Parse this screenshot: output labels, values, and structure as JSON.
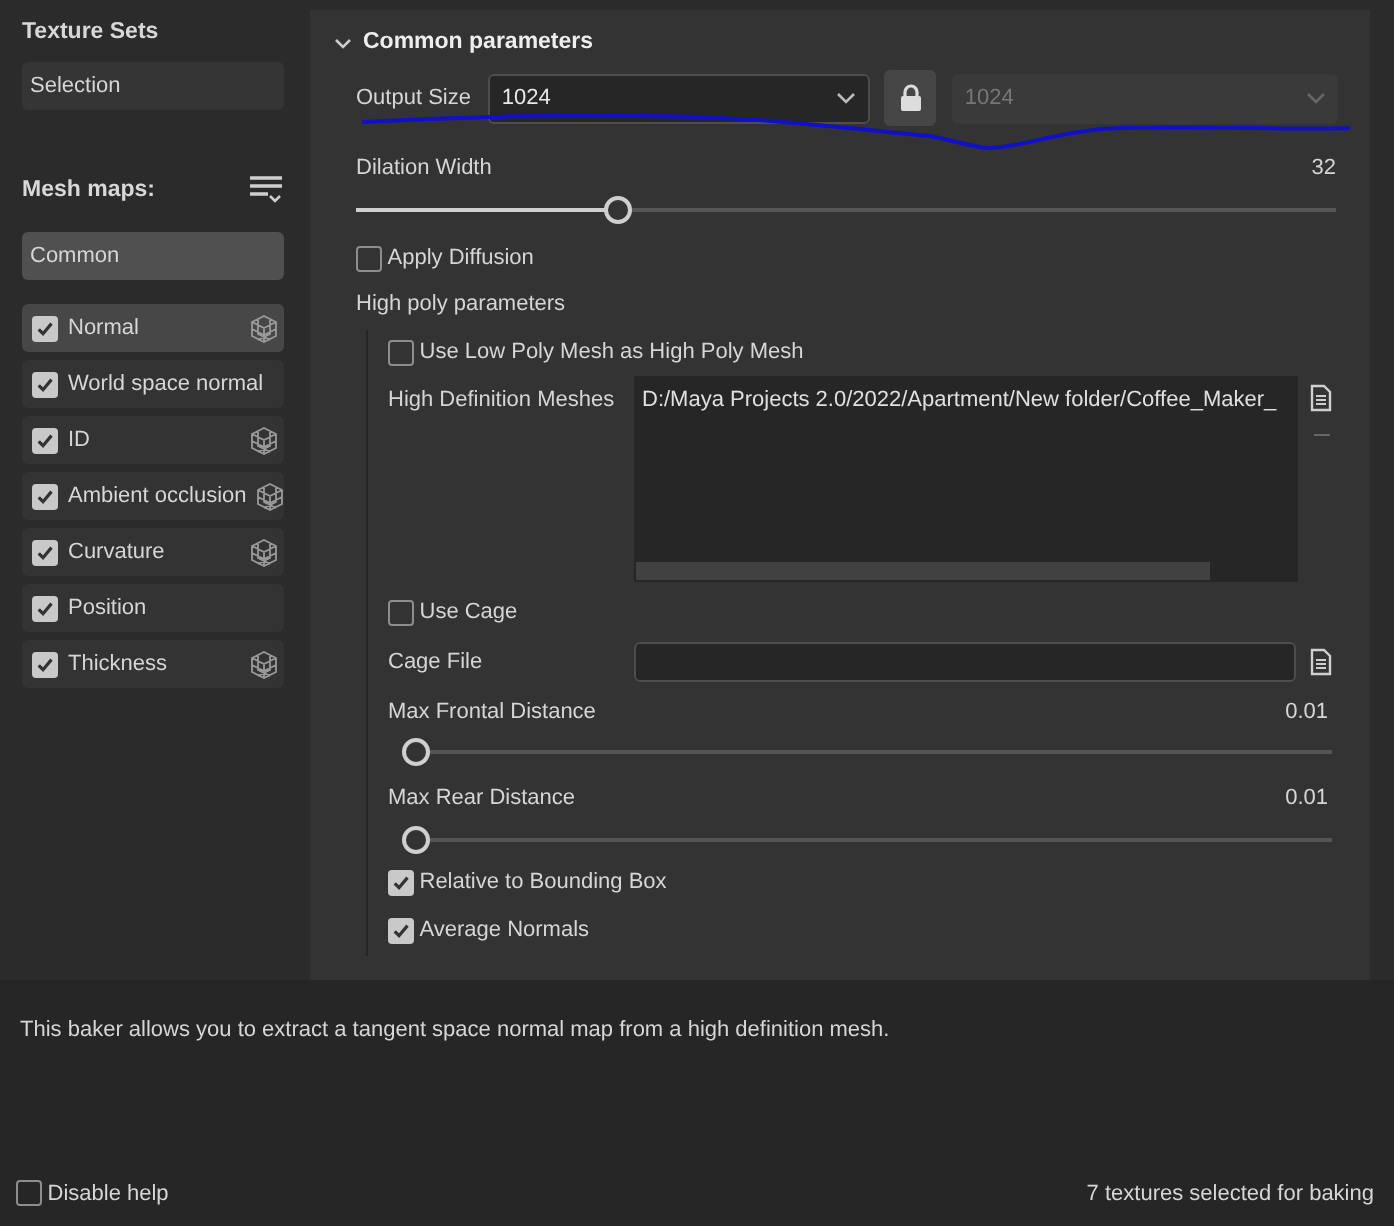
{
  "sidebar": {
    "texture_sets_title": "Texture Sets",
    "texture_set": "Selection",
    "mesh_maps_title": "Mesh maps:",
    "group": "Common",
    "mesh_maps": [
      {
        "label": "Normal",
        "checked": true,
        "selected": true,
        "cube_icon": true
      },
      {
        "label": "World space normal",
        "checked": true,
        "selected": false,
        "cube_icon": false
      },
      {
        "label": "ID",
        "checked": true,
        "selected": false,
        "cube_icon": true
      },
      {
        "label": "Ambient occlusion",
        "checked": true,
        "selected": false,
        "cube_icon": true
      },
      {
        "label": "Curvature",
        "checked": true,
        "selected": false,
        "cube_icon": true
      },
      {
        "label": "Position",
        "checked": true,
        "selected": false,
        "cube_icon": false
      },
      {
        "label": "Thickness",
        "checked": true,
        "selected": false,
        "cube_icon": true
      }
    ]
  },
  "panel": {
    "title": "Common parameters",
    "expanded": true,
    "output_size": {
      "label": "Output Size",
      "value": "1024",
      "locked": true,
      "second_value": "1024"
    },
    "dilation": {
      "label": "Dilation Width",
      "reading": "32",
      "level": 0.26
    },
    "apply_diffusion": {
      "label": "Apply Diffusion",
      "checked": false
    },
    "high_poly_title": "High poly parameters",
    "use_low_poly": {
      "label": "Use Low Poly Mesh as High Poly Mesh",
      "checked": false
    },
    "high_def_meshes": {
      "label": "High Definition Meshes",
      "files": [
        "D:/Maya Projects 2.0/2022/Apartment/New folder/Coffee_Maker_"
      ]
    },
    "use_cage": {
      "label": "Use Cage",
      "checked": false
    },
    "cage_file": {
      "label": "Cage File"
    },
    "max_frontal": {
      "label": "Max Frontal Distance",
      "reading": "0.01",
      "level": 0
    },
    "max_rear": {
      "label": "Max Rear Distance",
      "reading": "0.01",
      "level": 0
    },
    "options": [
      {
        "label": "Relative to Bounding Box",
        "checked": true
      },
      {
        "label": "Average Normals",
        "checked": true
      }
    ]
  },
  "help": {
    "text": "This baker allows you to extract a tangent space normal map from a high definition mesh.",
    "disable_help": {
      "label": "Disable help",
      "checked": false
    },
    "status": "7 textures selected for baking"
  }
}
